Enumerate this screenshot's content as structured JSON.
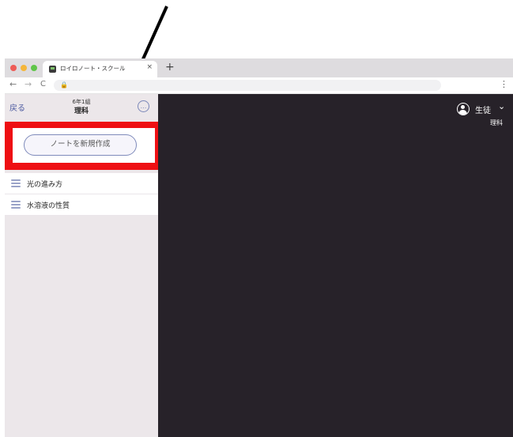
{
  "browser": {
    "tab_title": "ロイロノート・スクール",
    "tab_close": "×",
    "new_tab": "+",
    "back_arrow": "←",
    "forward_arrow": "→",
    "reload": "C",
    "lock": "🔒",
    "menu": "⋮",
    "traffic_colors": [
      "#ee5b56",
      "#f5b63a",
      "#5fc549"
    ]
  },
  "sidebar": {
    "back_label": "戻る",
    "class_name": "6年1組",
    "subject": "理科",
    "more_label": "…",
    "new_note_label": "ノートを新規作成",
    "items": [
      {
        "label": "光の進み方",
        "icon": "stack-icon"
      },
      {
        "label": "水溶液の性質",
        "icon": "stack-icon"
      }
    ]
  },
  "main": {
    "user_role": "生徒",
    "user_chevron": "⌄",
    "user_subject": "理科"
  },
  "annotation": {
    "highlight_color": "#ee0f13",
    "arrow_color": "#000000"
  }
}
